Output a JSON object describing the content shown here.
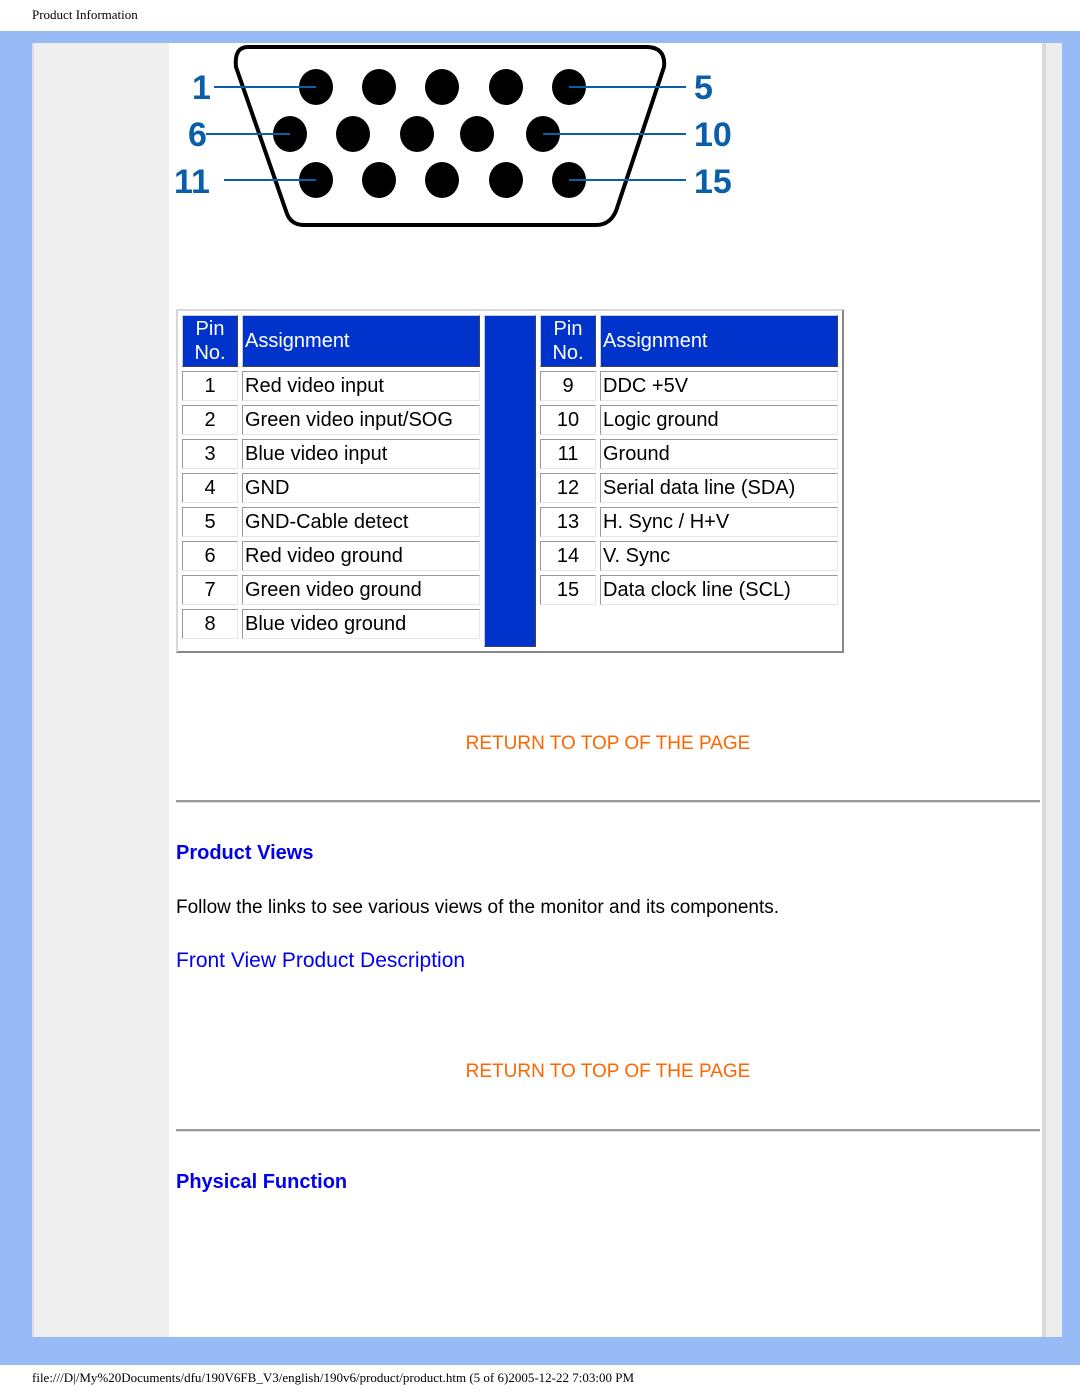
{
  "print_header": "Product Information",
  "print_footer": "file:///D|/My%20Documents/dfu/190V6FB_V3/english/190v6/product/product.htm (5 of 6)2005-12-22 7:03:00 PM",
  "connector": {
    "icon": "vga-15pin-connector-diagram",
    "labels": {
      "top_left": "1",
      "top_right": "5",
      "mid_left": "6",
      "mid_right": "10",
      "bot_left": "11",
      "bot_right": "15"
    },
    "label_color": "#0a5fa8"
  },
  "pin_table": {
    "header_color": "#0033cc",
    "left": {
      "header_pin": [
        "Pin",
        "No."
      ],
      "header_assignment": "Assignment",
      "rows": [
        {
          "pin": "1",
          "assignment": "Red video input"
        },
        {
          "pin": "2",
          "assignment": "Green video input/SOG"
        },
        {
          "pin": "3",
          "assignment": "Blue video input"
        },
        {
          "pin": "4",
          "assignment": "GND"
        },
        {
          "pin": "5",
          "assignment": "GND-Cable detect"
        },
        {
          "pin": "6",
          "assignment": "Red video ground"
        },
        {
          "pin": "7",
          "assignment": "Green video ground"
        },
        {
          "pin": "8",
          "assignment": "Blue video ground"
        }
      ]
    },
    "right": {
      "header_pin": [
        "Pin",
        "No."
      ],
      "header_assignment": "Assignment",
      "rows": [
        {
          "pin": "9",
          "assignment": "DDC +5V"
        },
        {
          "pin": "10",
          "assignment": "Logic ground"
        },
        {
          "pin": "11",
          "assignment": "Ground"
        },
        {
          "pin": "12",
          "assignment": "Serial data line (SDA)"
        },
        {
          "pin": "13",
          "assignment": "H. Sync / H+V"
        },
        {
          "pin": "14",
          "assignment": "V. Sync"
        },
        {
          "pin": "15",
          "assignment": "Data clock line (SCL)"
        }
      ]
    }
  },
  "return_top_label": "RETURN TO TOP OF THE PAGE",
  "sections": {
    "product_views": {
      "title": "Product Views",
      "description": "Follow the links to see various views of the monitor and its components.",
      "link": "Front View Product Description"
    },
    "physical_function": {
      "title": "Physical Function"
    }
  },
  "colors": {
    "frame": "#99bbf5",
    "link": "#0000ee",
    "return_link": "#ff6600"
  }
}
